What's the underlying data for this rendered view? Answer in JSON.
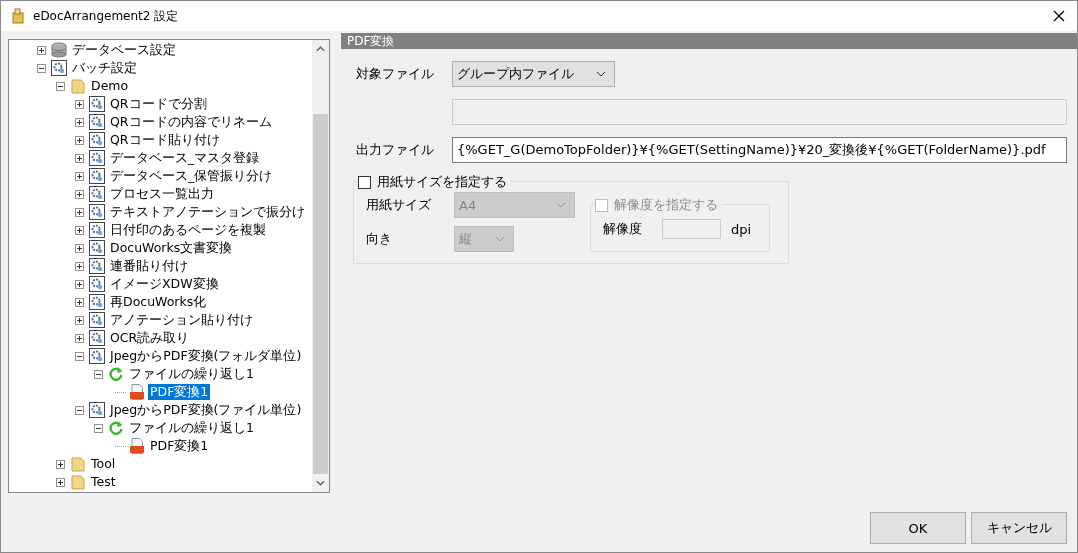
{
  "window": {
    "title": "eDocArrangement2 設定"
  },
  "tree": {
    "nodes": [
      {
        "label": "データベース設定",
        "kind": "database",
        "expanded": false,
        "selected": false
      },
      {
        "label": "バッチ設定",
        "kind": "batch",
        "expanded": true,
        "selected": false,
        "children": [
          {
            "label": "Demo",
            "kind": "folder",
            "expanded": true,
            "selected": false,
            "children": [
              {
                "label": "QRコードで分割",
                "kind": "batch",
                "expanded": false,
                "selected": false
              },
              {
                "label": "QRコードの内容でリネーム",
                "kind": "batch",
                "expanded": false,
                "selected": false
              },
              {
                "label": "QRコード貼り付け",
                "kind": "batch",
                "expanded": false,
                "selected": false
              },
              {
                "label": "データベース_マスタ登録",
                "kind": "batch",
                "expanded": false,
                "selected": false
              },
              {
                "label": "データベース_保管振り分け",
                "kind": "batch",
                "expanded": false,
                "selected": false
              },
              {
                "label": "プロセス一覧出力",
                "kind": "batch",
                "expanded": false,
                "selected": false
              },
              {
                "label": "テキストアノテーションで振分け",
                "kind": "batch",
                "expanded": false,
                "selected": false
              },
              {
                "label": "日付印のあるページを複製",
                "kind": "batch",
                "expanded": false,
                "selected": false
              },
              {
                "label": "DocuWorks文書変換",
                "kind": "batch",
                "expanded": false,
                "selected": false
              },
              {
                "label": "連番貼り付け",
                "kind": "batch",
                "expanded": false,
                "selected": false
              },
              {
                "label": "イメージXDW変換",
                "kind": "batch",
                "expanded": false,
                "selected": false
              },
              {
                "label": "再DocuWorks化",
                "kind": "batch",
                "expanded": false,
                "selected": false
              },
              {
                "label": "アノテーション貼り付け",
                "kind": "batch",
                "expanded": false,
                "selected": false
              },
              {
                "label": "OCR読み取り",
                "kind": "batch",
                "expanded": false,
                "selected": false
              },
              {
                "label": "JpegからPDF変換(フォルダ単位)",
                "kind": "batch",
                "expanded": true,
                "selected": false,
                "children": [
                  {
                    "label": "ファイルの繰り返し1",
                    "kind": "loop",
                    "expanded": true,
                    "selected": false,
                    "children": [
                      {
                        "label": "PDF変換1",
                        "kind": "pdf",
                        "selected": true
                      }
                    ]
                  }
                ]
              },
              {
                "label": "JpegからPDF変換(ファイル単位)",
                "kind": "batch",
                "expanded": true,
                "selected": false,
                "children": [
                  {
                    "label": "ファイルの繰り返し1",
                    "kind": "loop",
                    "expanded": true,
                    "selected": false,
                    "children": [
                      {
                        "label": "PDF変換1",
                        "kind": "pdf",
                        "selected": false
                      }
                    ]
                  }
                ]
              }
            ]
          },
          {
            "label": "Tool",
            "kind": "folder",
            "expanded": false,
            "selected": false
          },
          {
            "label": "Test",
            "kind": "folder",
            "expanded": false,
            "selected": false
          }
        ]
      }
    ]
  },
  "form": {
    "header": "PDF変換",
    "target_file": {
      "label": "対象ファイル",
      "value": "グループ内ファイル"
    },
    "blank_field": {
      "disabled": true
    },
    "output_file": {
      "label": "出力ファイル",
      "value": "{%GET_G(DemoTopFolder)}¥{%GET(SettingName)}¥20_変換後¥{%GET(FolderName)}.pdf"
    },
    "paper_group": {
      "label": "用紙サイズを指定する",
      "checked": false,
      "paper_size": {
        "label": "用紙サイズ",
        "value": "A4",
        "disabled": true
      },
      "orientation": {
        "label": "向き",
        "value": "縦",
        "disabled": true
      },
      "resolution_group": {
        "label": "解像度を指定する",
        "checked": false,
        "disabled": true,
        "field_label": "解像度",
        "unit": "dpi"
      }
    }
  },
  "buttons": [
    {
      "label": "OK"
    },
    {
      "label": "キャンセル"
    }
  ]
}
